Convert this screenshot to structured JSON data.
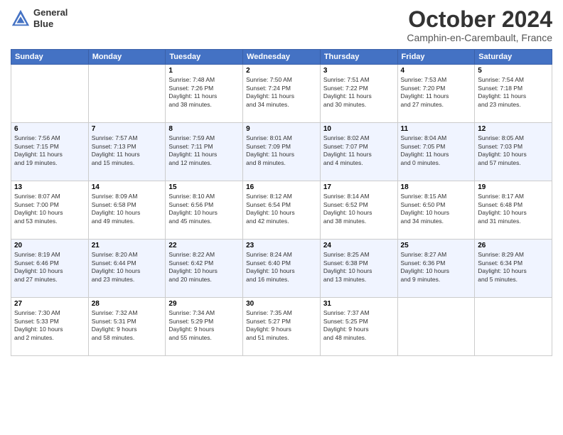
{
  "header": {
    "logo_line1": "General",
    "logo_line2": "Blue",
    "month": "October 2024",
    "location": "Camphin-en-Carembault, France"
  },
  "days_of_week": [
    "Sunday",
    "Monday",
    "Tuesday",
    "Wednesday",
    "Thursday",
    "Friday",
    "Saturday"
  ],
  "weeks": [
    [
      {
        "day": "",
        "info": ""
      },
      {
        "day": "",
        "info": ""
      },
      {
        "day": "1",
        "info": "Sunrise: 7:48 AM\nSunset: 7:26 PM\nDaylight: 11 hours\nand 38 minutes."
      },
      {
        "day": "2",
        "info": "Sunrise: 7:50 AM\nSunset: 7:24 PM\nDaylight: 11 hours\nand 34 minutes."
      },
      {
        "day": "3",
        "info": "Sunrise: 7:51 AM\nSunset: 7:22 PM\nDaylight: 11 hours\nand 30 minutes."
      },
      {
        "day": "4",
        "info": "Sunrise: 7:53 AM\nSunset: 7:20 PM\nDaylight: 11 hours\nand 27 minutes."
      },
      {
        "day": "5",
        "info": "Sunrise: 7:54 AM\nSunset: 7:18 PM\nDaylight: 11 hours\nand 23 minutes."
      }
    ],
    [
      {
        "day": "6",
        "info": "Sunrise: 7:56 AM\nSunset: 7:15 PM\nDaylight: 11 hours\nand 19 minutes."
      },
      {
        "day": "7",
        "info": "Sunrise: 7:57 AM\nSunset: 7:13 PM\nDaylight: 11 hours\nand 15 minutes."
      },
      {
        "day": "8",
        "info": "Sunrise: 7:59 AM\nSunset: 7:11 PM\nDaylight: 11 hours\nand 12 minutes."
      },
      {
        "day": "9",
        "info": "Sunrise: 8:01 AM\nSunset: 7:09 PM\nDaylight: 11 hours\nand 8 minutes."
      },
      {
        "day": "10",
        "info": "Sunrise: 8:02 AM\nSunset: 7:07 PM\nDaylight: 11 hours\nand 4 minutes."
      },
      {
        "day": "11",
        "info": "Sunrise: 8:04 AM\nSunset: 7:05 PM\nDaylight: 11 hours\nand 0 minutes."
      },
      {
        "day": "12",
        "info": "Sunrise: 8:05 AM\nSunset: 7:03 PM\nDaylight: 10 hours\nand 57 minutes."
      }
    ],
    [
      {
        "day": "13",
        "info": "Sunrise: 8:07 AM\nSunset: 7:00 PM\nDaylight: 10 hours\nand 53 minutes."
      },
      {
        "day": "14",
        "info": "Sunrise: 8:09 AM\nSunset: 6:58 PM\nDaylight: 10 hours\nand 49 minutes."
      },
      {
        "day": "15",
        "info": "Sunrise: 8:10 AM\nSunset: 6:56 PM\nDaylight: 10 hours\nand 45 minutes."
      },
      {
        "day": "16",
        "info": "Sunrise: 8:12 AM\nSunset: 6:54 PM\nDaylight: 10 hours\nand 42 minutes."
      },
      {
        "day": "17",
        "info": "Sunrise: 8:14 AM\nSunset: 6:52 PM\nDaylight: 10 hours\nand 38 minutes."
      },
      {
        "day": "18",
        "info": "Sunrise: 8:15 AM\nSunset: 6:50 PM\nDaylight: 10 hours\nand 34 minutes."
      },
      {
        "day": "19",
        "info": "Sunrise: 8:17 AM\nSunset: 6:48 PM\nDaylight: 10 hours\nand 31 minutes."
      }
    ],
    [
      {
        "day": "20",
        "info": "Sunrise: 8:19 AM\nSunset: 6:46 PM\nDaylight: 10 hours\nand 27 minutes."
      },
      {
        "day": "21",
        "info": "Sunrise: 8:20 AM\nSunset: 6:44 PM\nDaylight: 10 hours\nand 23 minutes."
      },
      {
        "day": "22",
        "info": "Sunrise: 8:22 AM\nSunset: 6:42 PM\nDaylight: 10 hours\nand 20 minutes."
      },
      {
        "day": "23",
        "info": "Sunrise: 8:24 AM\nSunset: 6:40 PM\nDaylight: 10 hours\nand 16 minutes."
      },
      {
        "day": "24",
        "info": "Sunrise: 8:25 AM\nSunset: 6:38 PM\nDaylight: 10 hours\nand 13 minutes."
      },
      {
        "day": "25",
        "info": "Sunrise: 8:27 AM\nSunset: 6:36 PM\nDaylight: 10 hours\nand 9 minutes."
      },
      {
        "day": "26",
        "info": "Sunrise: 8:29 AM\nSunset: 6:34 PM\nDaylight: 10 hours\nand 5 minutes."
      }
    ],
    [
      {
        "day": "27",
        "info": "Sunrise: 7:30 AM\nSunset: 5:33 PM\nDaylight: 10 hours\nand 2 minutes."
      },
      {
        "day": "28",
        "info": "Sunrise: 7:32 AM\nSunset: 5:31 PM\nDaylight: 9 hours\nand 58 minutes."
      },
      {
        "day": "29",
        "info": "Sunrise: 7:34 AM\nSunset: 5:29 PM\nDaylight: 9 hours\nand 55 minutes."
      },
      {
        "day": "30",
        "info": "Sunrise: 7:35 AM\nSunset: 5:27 PM\nDaylight: 9 hours\nand 51 minutes."
      },
      {
        "day": "31",
        "info": "Sunrise: 7:37 AM\nSunset: 5:25 PM\nDaylight: 9 hours\nand 48 minutes."
      },
      {
        "day": "",
        "info": ""
      },
      {
        "day": "",
        "info": ""
      }
    ]
  ]
}
